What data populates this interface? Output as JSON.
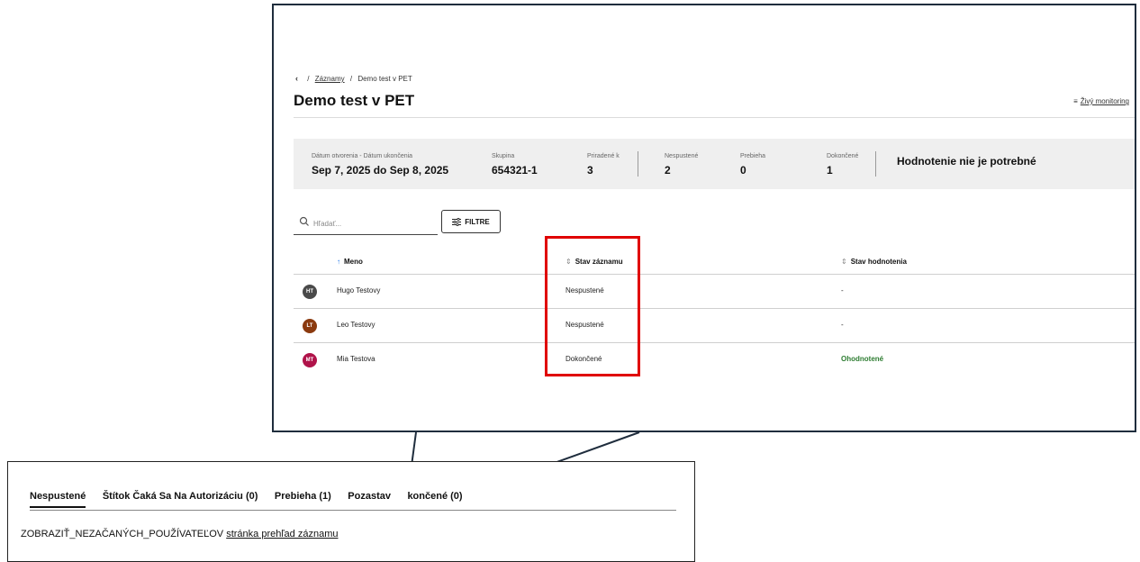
{
  "breadcrumb": {
    "back": "‹",
    "link": "Záznamy",
    "separator": "/",
    "current": "Demo test v PET"
  },
  "page_title": "Demo test v PET",
  "monitoring_link": "Živý monitoring",
  "summary": {
    "date_label": "Dátum otvorenia - Dátum ukončenia",
    "date_value": "Sep 7, 2025 do Sep 8, 2025",
    "group_label": "Skupina",
    "group_value": "654321-1",
    "assigned_label": "Priradené k",
    "assigned_value": "3",
    "not_started_label": "Nespustené",
    "not_started_value": "2",
    "in_progress_label": "Prebieha",
    "in_progress_value": "0",
    "completed_label": "Dokončené",
    "completed_value": "1",
    "evaluation_text": "Hodnotenie nie je potrebné"
  },
  "search": {
    "placeholder": "Hľadať..."
  },
  "filter_button": "FILTRE",
  "table": {
    "columns": {
      "name": "Meno",
      "record_status": "Stav záznamu",
      "evaluation_status": "Stav hodnotenia"
    },
    "rows": [
      {
        "initials": "HT",
        "name": "Hugo Testovy",
        "record_status": "Nespustené",
        "evaluation_status": "-",
        "avatar_color": "#4a4a4a"
      },
      {
        "initials": "LT",
        "name": "Leo Testovy",
        "record_status": "Nespustené",
        "evaluation_status": "-",
        "avatar_color": "#8b3a0f"
      },
      {
        "initials": "MT",
        "name": "Mia Testova",
        "record_status": "Dokončené",
        "evaluation_status": "Ohodnotené",
        "avatar_color": "#b0134a"
      }
    ]
  },
  "bottom_panel": {
    "tabs": [
      "Nespustené",
      "Štítok Čaká Sa Na Autorizáciu (0)",
      "Prebieha (1)",
      "Pozastav",
      "končené (0)"
    ],
    "page_text": "ZOBRAZIŤ_NEZAČANÝCH_POUŽÍVATEĽOV",
    "page_link": "stránka prehľad záznamu"
  },
  "colors": {
    "highlight": "#e00000",
    "summary_bg": "#efefef",
    "evaluated_green": "#2e7d32",
    "sort_active": "#1a73e8"
  }
}
